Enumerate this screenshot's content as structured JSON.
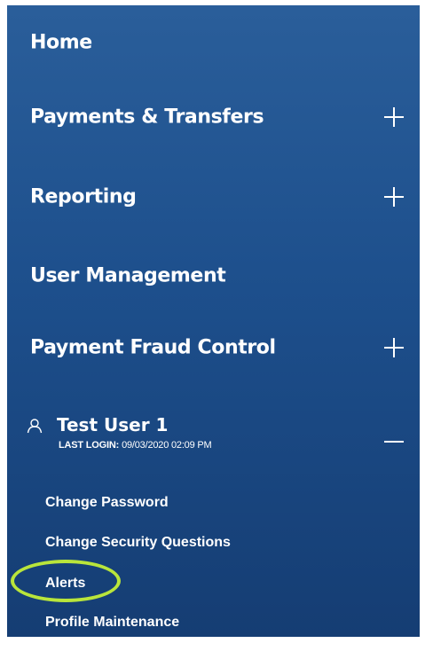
{
  "nav": {
    "items": [
      {
        "label": "Home",
        "expandable": false
      },
      {
        "label": "Payments & Transfers",
        "expandable": true
      },
      {
        "label": "Reporting",
        "expandable": true
      },
      {
        "label": "User Management",
        "expandable": false
      },
      {
        "label": "Payment Fraud Control",
        "expandable": true
      }
    ]
  },
  "user": {
    "name": "Test User 1",
    "last_login_label": "LAST LOGIN:",
    "last_login_value": "09/03/2020 02:09 PM",
    "expanded": true,
    "submenu": [
      {
        "label": "Change Password"
      },
      {
        "label": "Change Security Questions"
      },
      {
        "label": "Alerts",
        "highlighted": true
      },
      {
        "label": "Profile Maintenance"
      }
    ]
  },
  "colors": {
    "panel_top": "#2a5e9a",
    "panel_bottom": "#153d73",
    "highlight_ring": "#b9e53b",
    "text": "#ffffff"
  }
}
